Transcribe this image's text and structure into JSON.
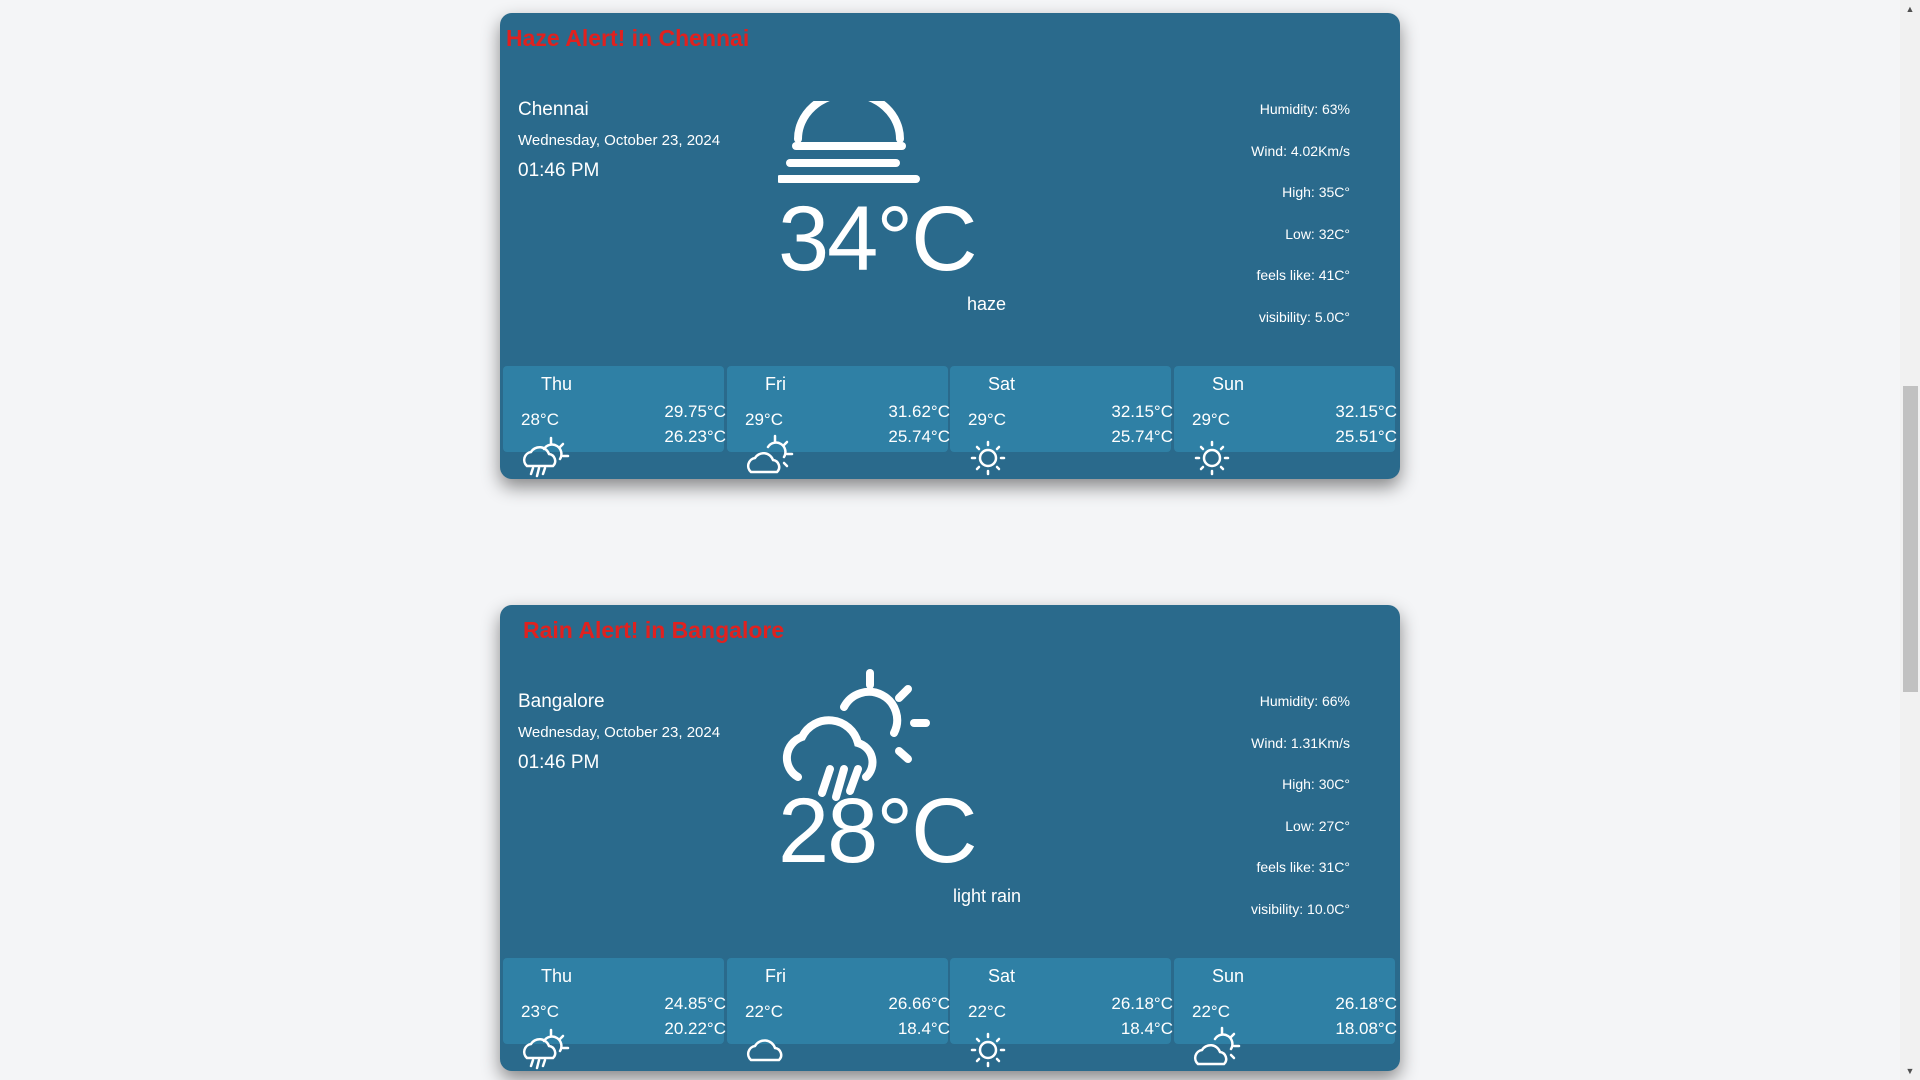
{
  "cards": [
    {
      "alert": "Haze Alert! in Chennai",
      "city": "Chennai",
      "date": "Wednesday, October 23, 2024",
      "time": "01:46 PM",
      "temp": "34°C",
      "condition": "haze",
      "main_icon": "haze-icon",
      "stats": {
        "humidity": "Humidity: 63%",
        "wind": "Wind: 4.02Km/s",
        "high": "High: 35C°",
        "low": "Low: 32C°",
        "feels_like": "feels like: 41C°",
        "visibility": "visibility: 5.0C°"
      },
      "forecast": [
        {
          "day": "Thu",
          "temp": "28°C",
          "high": "29.75°C",
          "low": "26.23°C",
          "icon": "rain-sun-icon"
        },
        {
          "day": "Fri",
          "temp": "29°C",
          "high": "31.62°C",
          "low": "25.74°C",
          "icon": "partly-cloudy-icon"
        },
        {
          "day": "Sat",
          "temp": "29°C",
          "high": "32.15°C",
          "low": "25.74°C",
          "icon": "sun-icon"
        },
        {
          "day": "Sun",
          "temp": "29°C",
          "high": "32.15°C",
          "low": "25.51°C",
          "icon": "sun-icon"
        }
      ]
    },
    {
      "alert": "Rain Alert! in Bangalore",
      "city": "Bangalore",
      "date": "Wednesday, October 23, 2024",
      "time": "01:46 PM",
      "temp": "28°C",
      "condition": "light rain",
      "main_icon": "rain-sun-icon",
      "stats": {
        "humidity": "Humidity: 66%",
        "wind": "Wind: 1.31Km/s",
        "high": "High: 30C°",
        "low": "Low: 27C°",
        "feels_like": "feels like: 31C°",
        "visibility": "visibility: 10.0C°"
      },
      "forecast": [
        {
          "day": "Thu",
          "temp": "23°C",
          "high": "24.85°C",
          "low": "20.22°C",
          "icon": "rain-sun-icon"
        },
        {
          "day": "Fri",
          "temp": "22°C",
          "high": "26.66°C",
          "low": "18.4°C",
          "icon": "cloud-icon"
        },
        {
          "day": "Sat",
          "temp": "22°C",
          "high": "26.18°C",
          "low": "18.4°C",
          "icon": "sun-icon"
        },
        {
          "day": "Sun",
          "temp": "22°C",
          "high": "26.18°C",
          "low": "18.08°C",
          "icon": "partly-cloudy-icon"
        }
      ]
    }
  ],
  "colors": {
    "card_bg": "#2a6a8c",
    "forecast_bg": "#2f80a5",
    "alert": "#e0211f",
    "page_bg": "#f4f5f7"
  }
}
